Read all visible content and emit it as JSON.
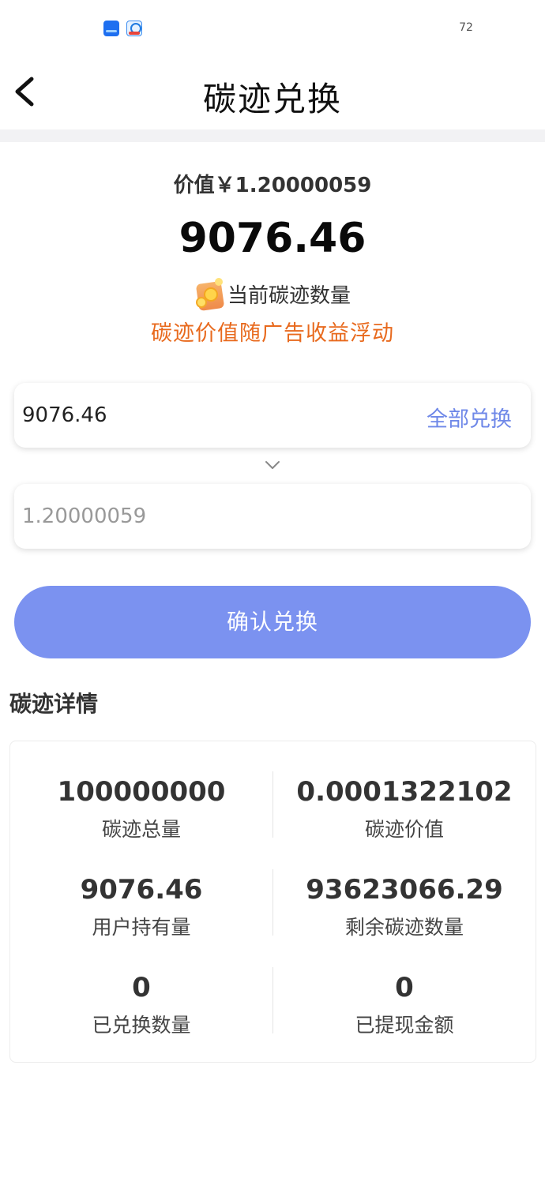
{
  "status_bar": {
    "battery_text": "72",
    "app_icons": [
      "blue-app-icon",
      "search-app-icon"
    ]
  },
  "nav": {
    "title": "碳迹兑换",
    "back_icon": "chevron-left-icon"
  },
  "summary": {
    "value_line": "价值￥1.20000059",
    "amount": "9076.46",
    "current_label": "当前碳迹数量",
    "current_icon": "coin-box-icon",
    "note": "碳迹价值随广告收益浮动",
    "note_color": "#e86a1e"
  },
  "exchange": {
    "input_value": "9076.46",
    "all_exchange_label": "全部兑换",
    "arrow_icon": "chevron-down-icon",
    "output_placeholder": "1.20000059",
    "confirm_label": "确认兑换",
    "accent_color": "#7b92f0"
  },
  "details": {
    "title": "碳迹详情",
    "stats": [
      {
        "value": "100000000",
        "label": "碳迹总量"
      },
      {
        "value": "0.0001322102",
        "label": "碳迹价值"
      },
      {
        "value": "9076.46",
        "label": "用户持有量"
      },
      {
        "value": "93623066.29",
        "label": "剩余碳迹数量"
      },
      {
        "value": "0",
        "label": "已兑换数量"
      },
      {
        "value": "0",
        "label": "已提现金额"
      }
    ]
  }
}
